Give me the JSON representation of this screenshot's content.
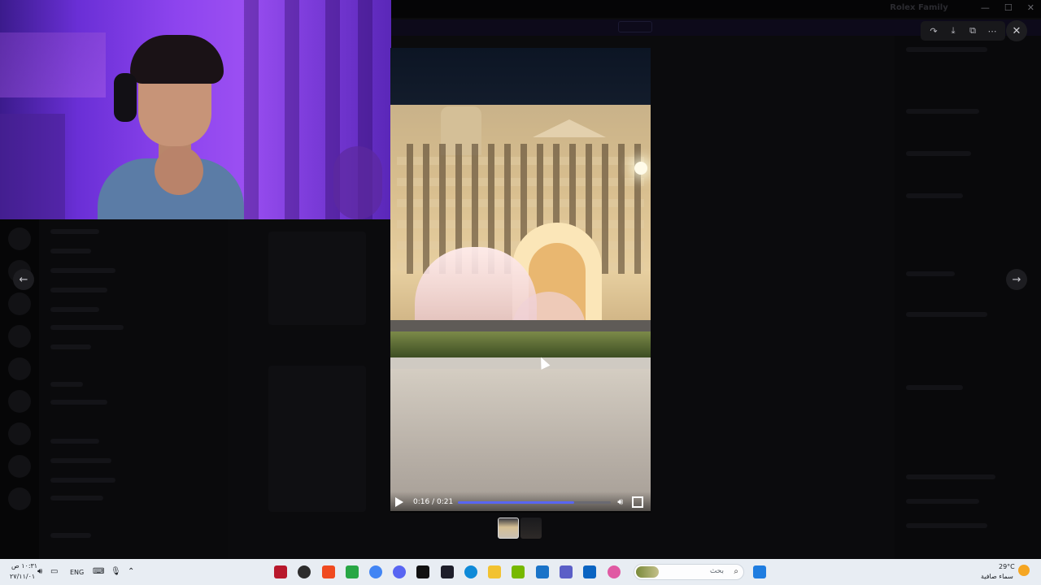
{
  "background_app": {
    "title": "Rolex Family"
  },
  "viewer": {
    "actions": [
      "forward-icon",
      "download-icon",
      "open-external-icon",
      "more-icon"
    ],
    "close": "close-icon",
    "prev": "arrow-left-icon",
    "next": "arrow-right-icon"
  },
  "video": {
    "time": "0:16 / 0:21",
    "progress": 0.76
  },
  "taskbar": {
    "time": "١٠:٣١ ص",
    "date": "٢٧/١١/٠١",
    "language": "ENG",
    "search_placeholder": "بحث",
    "temperature": "29°C",
    "weather": "سماء صافية"
  },
  "colors": {
    "accent": "#5865f2",
    "taskbar": "#e8edf3"
  }
}
